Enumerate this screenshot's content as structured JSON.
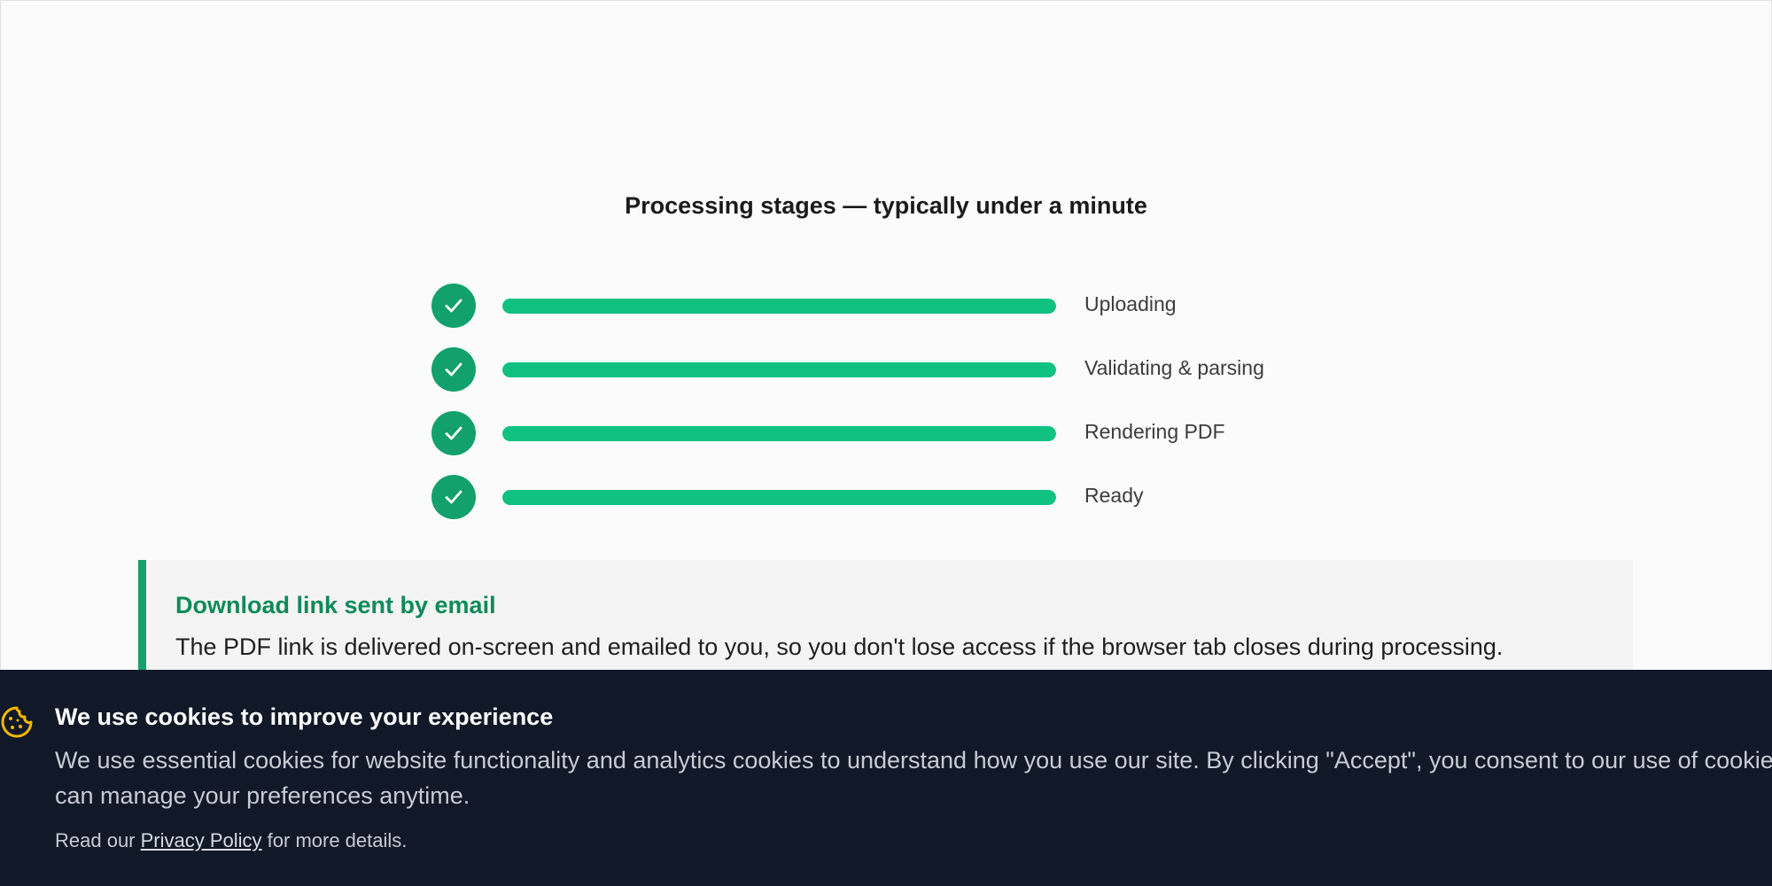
{
  "stages_heading": "Processing stages — typically under a minute",
  "stages": [
    {
      "label": "Uploading",
      "status": "complete",
      "progress": 1.0
    },
    {
      "label": "Validating & parsing",
      "status": "complete",
      "progress": 1.0
    },
    {
      "label": "Rendering PDF",
      "status": "complete",
      "progress": 1.0
    },
    {
      "label": "Ready",
      "status": "complete",
      "progress": 1.0
    }
  ],
  "callout": {
    "title": "Download link sent by email",
    "body": "The PDF link is delivered on-screen and emailed to you, so you don't lose access if the browser tab closes during processing."
  },
  "cookie_banner": {
    "icon": "cookie-icon",
    "title": "We use cookies to improve your experience",
    "body": "We use essential cookies for website functionality and analytics cookies to understand how you use our site. By clicking \"Accept\", you consent to our use of cookies. You can manage your preferences anytime.",
    "privacy_prefix": "Read our ",
    "privacy_link": "Privacy Policy",
    "privacy_suffix": " for more details."
  },
  "colors": {
    "accent_green": "#12a16d",
    "progress_green": "#10c182",
    "banner_bg": "#111827",
    "cookie_icon": "#f5b800"
  }
}
